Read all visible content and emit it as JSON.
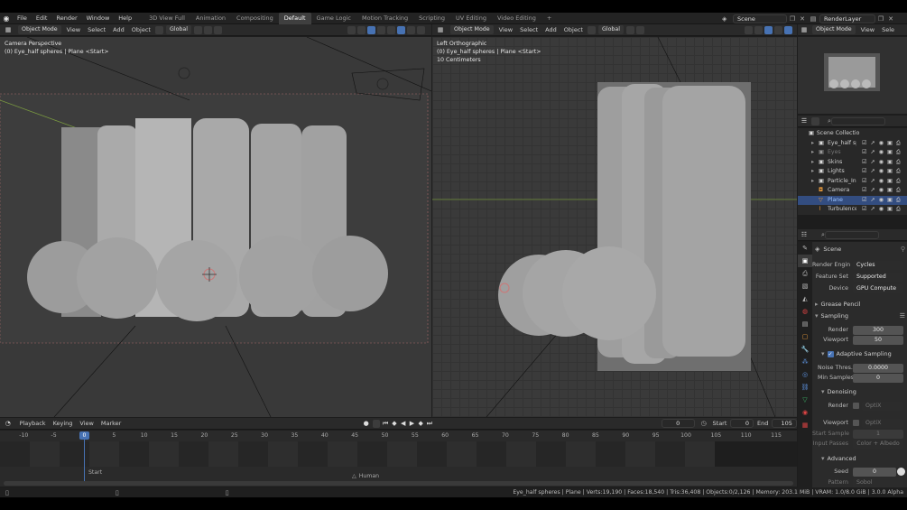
{
  "menubar": {
    "items": [
      "File",
      "Edit",
      "Render",
      "Window",
      "Help"
    ]
  },
  "workspaces": {
    "tabs": [
      "3D View Full",
      "Animation",
      "Compositing",
      "Default",
      "Game Logic",
      "Motion Tracking",
      "Scripting",
      "UV Editing",
      "Video Editing"
    ],
    "active": "Default",
    "add": "+"
  },
  "scene": {
    "name": "Scene",
    "render_layer": "RenderLayer"
  },
  "viewport_left": {
    "mode": "Object Mode",
    "menus": [
      "View",
      "Select",
      "Add",
      "Object"
    ],
    "transform": "Global",
    "title": "Camera Perspective",
    "subtitle": "(0) Eye_half spheres | Plane <Start>"
  },
  "viewport_right": {
    "mode": "Object Mode",
    "menus": [
      "View",
      "Select",
      "Add",
      "Object"
    ],
    "transform": "Global",
    "title": "Left Orthographic",
    "subtitle": "(0) Eye_half spheres | Plane <Start>",
    "scale": "10 Centimeters"
  },
  "properties_header": {
    "mode": "Object Mode",
    "menus": [
      "View",
      "Sele"
    ]
  },
  "outliner": {
    "root": "Scene Collectio",
    "items": [
      {
        "label": "Eye_half spl",
        "selected": false,
        "dim": false
      },
      {
        "label": "Eyes",
        "selected": false,
        "dim": true
      },
      {
        "label": "Skins",
        "selected": false,
        "dim": false
      },
      {
        "label": "Lights",
        "selected": false,
        "dim": false
      },
      {
        "label": "Particle_Ins",
        "selected": false,
        "dim": false
      },
      {
        "label": "Camera",
        "selected": false,
        "dim": false
      },
      {
        "label": "Plane",
        "selected": true,
        "dim": false
      },
      {
        "label": "Turbulence",
        "selected": false,
        "dim": false
      }
    ]
  },
  "properties": {
    "scene_label": "Scene",
    "render_engine_label": "Render Engin",
    "render_engine": "Cycles",
    "feature_set_label": "Feature Set",
    "feature_set": "Supported",
    "device_label": "Device",
    "device": "GPU Compute",
    "grease_pencil": "Grease Pencil",
    "sampling": "Sampling",
    "render_label": "Render",
    "render_samples": "300",
    "viewport_label": "Viewport",
    "viewport_samples": "50",
    "adaptive_sampling": "Adaptive Sampling",
    "noise_thresh_label": "Noise Thres...",
    "noise_thresh": "0.0000",
    "min_samples_label": "Min Samples",
    "min_samples": "0",
    "denoising": "Denoising",
    "den_render_label": "Render",
    "den_render_value": "OptiX",
    "den_viewport_label": "Viewport",
    "den_viewport_value": "OptiX",
    "start_sample_label": "Start Sample",
    "start_sample": "1",
    "input_passes_label": "Input Passes",
    "input_passes": "Color + Albedo",
    "advanced": "Advanced",
    "seed_label": "Seed",
    "seed": "0",
    "pattern_label": "Pattern",
    "pattern": "Sobol"
  },
  "timeline": {
    "menus": [
      "Playback",
      "Keying",
      "View",
      "Marker"
    ],
    "current_frame": "0",
    "start_label": "Start",
    "start": "0",
    "end_label": "End",
    "end": "105",
    "ticks": [
      "-10",
      "-5",
      "0",
      "5",
      "10",
      "15",
      "20",
      "25",
      "30",
      "35",
      "40",
      "45",
      "50",
      "55",
      "60",
      "65",
      "70",
      "75",
      "80",
      "85",
      "90",
      "95",
      "100",
      "105",
      "110",
      "115"
    ],
    "marker_start": "Start",
    "marker_human": "Human"
  },
  "statusbar": {
    "text": "Eye_half spheres | Plane | Verts:19,190 | Faces:18,540 | Tris:36,408 | Objects:0/2,126 | Memory: 203.1 MiB | VRAM: 1.0/8.0 GiB | 3.0.0 Alpha"
  },
  "colors": {
    "accent": "#4772b3",
    "selected_row": "#334d80",
    "viewport_bg": "#393939",
    "frame_marker": "#4772b3"
  }
}
